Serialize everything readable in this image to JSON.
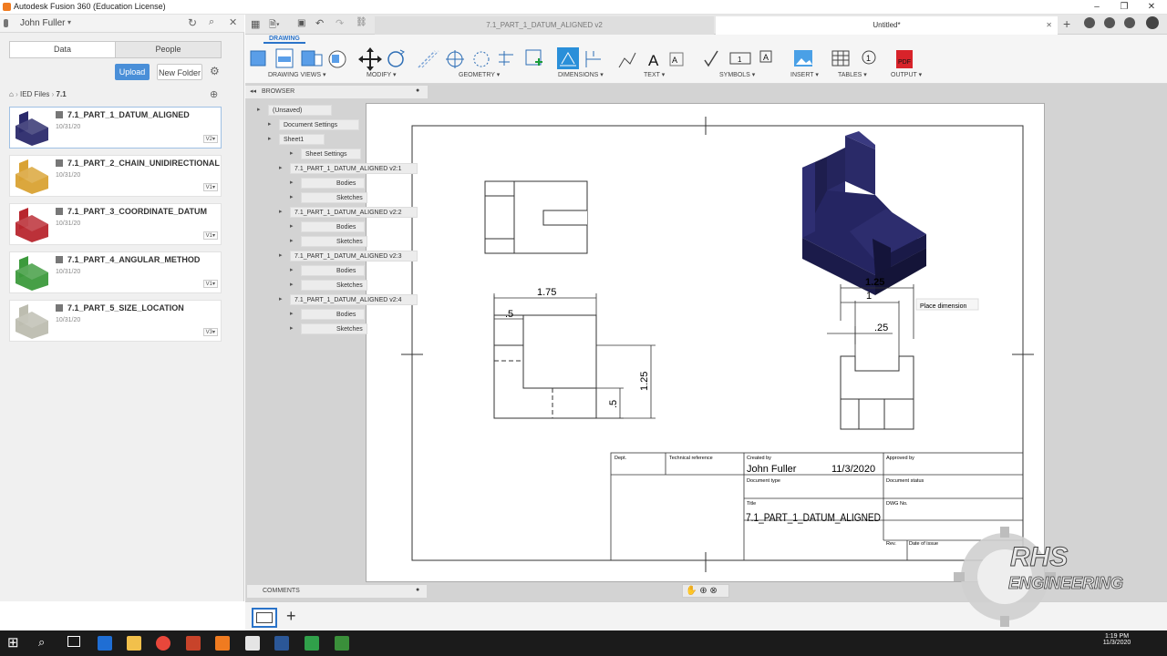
{
  "window": {
    "title": "Autodesk Fusion 360 (Education License)"
  },
  "data_panel": {
    "user": "John Fuller",
    "tabs": [
      "Data",
      "People"
    ],
    "upload_label": "Upload",
    "new_folder_label": "New Folder",
    "breadcrumb": [
      "IED Files",
      "7.1"
    ],
    "files": [
      {
        "name": "7.1_PART_1_DATUM_ALIGNED",
        "date": "10/31/20",
        "version": "V2",
        "color": "#2b2a6b"
      },
      {
        "name": "7.1_PART_2_CHAIN_UNIDIRECTIONAL",
        "date": "10/31/20",
        "version": "V1",
        "color": "#d9a233"
      },
      {
        "name": "7.1_PART_3_COORDINATE_DATUM",
        "date": "10/31/20",
        "version": "V1",
        "color": "#b8262e"
      },
      {
        "name": "7.1_PART_4_ANGULAR_METHOD",
        "date": "10/31/20",
        "version": "V1",
        "color": "#3c9a3c"
      },
      {
        "name": "7.1_PART_5_SIZE_LOCATION",
        "date": "10/31/20",
        "version": "V3",
        "color": "#bdbdb0"
      }
    ]
  },
  "doc_tabs": [
    {
      "label": "7.1_PART_1_DATUM_ALIGNED v2"
    },
    {
      "label": "Untitled*"
    }
  ],
  "toolbar": {
    "mode_tab": "DRAWING",
    "groups": [
      "DRAWING VIEWS ▾",
      "MODIFY ▾",
      "GEOMETRY ▾",
      "DIMENSIONS ▾",
      "TEXT ▾",
      "SYMBOLS ▾",
      "INSERT ▾",
      "TABLES ▾",
      "OUTPUT ▾"
    ]
  },
  "browser": {
    "title": "BROWSER",
    "root": "(Unsaved)",
    "document_settings": "Document Settings",
    "sheet": "Sheet1",
    "sheet_settings": "Sheet Settings",
    "components": [
      {
        "label": "7.1_PART_1_DATUM_ALIGNED v2:1",
        "children": [
          "Bodies",
          "Sketches"
        ]
      },
      {
        "label": "7.1_PART_1_DATUM_ALIGNED v2:2",
        "children": [
          "Bodies",
          "Sketches"
        ]
      },
      {
        "label": "7.1_PART_1_DATUM_ALIGNED v2:3",
        "children": [
          "Bodies",
          "Sketches"
        ]
      },
      {
        "label": "7.1_PART_1_DATUM_ALIGNED v2:4",
        "children": [
          "Bodies",
          "Sketches"
        ]
      }
    ]
  },
  "comments_label": "COMMENTS",
  "drawing": {
    "dims_front": {
      "width": "1.75",
      "offset": ".5",
      "height": "1.25",
      "step": ".5"
    },
    "dims_side": {
      "overall": "1.25",
      "inner": "1",
      "small": ".25"
    },
    "tooltip": "Place dimension"
  },
  "title_block": {
    "dept_label": "Dept.",
    "tech_ref_label": "Technical reference",
    "created_by_label": "Created by",
    "created_by": "John Fuller",
    "date": "11/3/2020",
    "approved_by_label": "Approved by",
    "doc_type_label": "Document type",
    "doc_status_label": "Document status",
    "title_label": "Title",
    "title": "7.1_PART_1_DATUM_ALIGNED",
    "dwg_no_label": "DWG No.",
    "rev_label": "Rev.",
    "date_issue_label": "Date of issue"
  },
  "watermark": {
    "line1": "RHS",
    "line2": "ENGINEERING"
  },
  "taskbar": {
    "time": "1:19 PM",
    "date": "11/3/2020"
  }
}
